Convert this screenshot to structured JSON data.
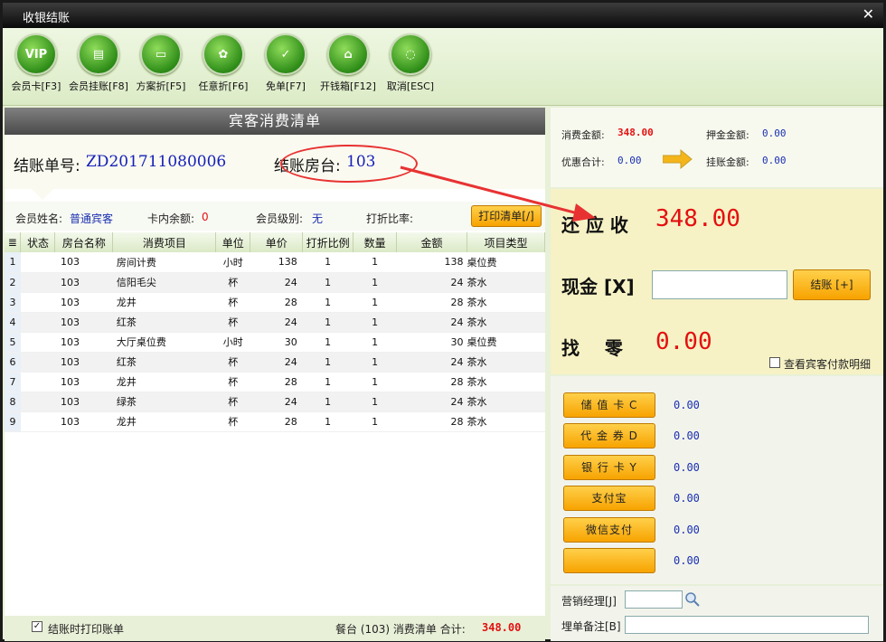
{
  "window": {
    "title": "收银结账",
    "close_label": "✕"
  },
  "toolbar": [
    {
      "label": "会员卡[F3]",
      "glyph": "VIP"
    },
    {
      "label": "会员挂账[F8]",
      "glyph": "▤"
    },
    {
      "label": "方案折[F5]",
      "glyph": "▭"
    },
    {
      "label": "任意折[F6]",
      "glyph": "✿"
    },
    {
      "label": "免单[F7]",
      "glyph": "✓"
    },
    {
      "label": "开钱箱[F12]",
      "glyph": "⌂"
    },
    {
      "label": "取消[ESC]",
      "glyph": "◌"
    }
  ],
  "left": {
    "header": "宾客消费清单",
    "bill_no_label": "结账单号:",
    "bill_no": "ZD201711080006",
    "room_label": "结账房台:",
    "room": "103",
    "member_name_label": "会员姓名:",
    "member_name": "普通宾客",
    "card_balance_label": "卡内余额:",
    "card_balance": "0",
    "member_level_label": "会员级别:",
    "member_level": "无",
    "discount_label": "打折比率:",
    "print_button": "打印清单[/]",
    "columns": [
      "状态",
      "房台名称",
      "消费项目",
      "单位",
      "单价",
      "打折比例",
      "数量",
      "金额",
      "项目类型"
    ],
    "rows": [
      {
        "n": "1",
        "room": "103",
        "item": "房间计费",
        "unit": "小时",
        "price": "138",
        "disc": "1",
        "qty": "1",
        "amount": "138",
        "type": "桌位费"
      },
      {
        "n": "2",
        "room": "103",
        "item": "信阳毛尖",
        "unit": "杯",
        "price": "24",
        "disc": "1",
        "qty": "1",
        "amount": "24",
        "type": "茶水"
      },
      {
        "n": "3",
        "room": "103",
        "item": "龙井",
        "unit": "杯",
        "price": "28",
        "disc": "1",
        "qty": "1",
        "amount": "28",
        "type": "茶水"
      },
      {
        "n": "4",
        "room": "103",
        "item": "红茶",
        "unit": "杯",
        "price": "24",
        "disc": "1",
        "qty": "1",
        "amount": "24",
        "type": "茶水"
      },
      {
        "n": "5",
        "room": "103",
        "item": "大厅桌位费",
        "unit": "小时",
        "price": "30",
        "disc": "1",
        "qty": "1",
        "amount": "30",
        "type": "桌位费"
      },
      {
        "n": "6",
        "room": "103",
        "item": "红茶",
        "unit": "杯",
        "price": "24",
        "disc": "1",
        "qty": "1",
        "amount": "24",
        "type": "茶水"
      },
      {
        "n": "7",
        "room": "103",
        "item": "龙井",
        "unit": "杯",
        "price": "28",
        "disc": "1",
        "qty": "1",
        "amount": "28",
        "type": "茶水"
      },
      {
        "n": "8",
        "room": "103",
        "item": "绿茶",
        "unit": "杯",
        "price": "24",
        "disc": "1",
        "qty": "1",
        "amount": "24",
        "type": "茶水"
      },
      {
        "n": "9",
        "room": "103",
        "item": "龙井",
        "unit": "杯",
        "price": "28",
        "disc": "1",
        "qty": "1",
        "amount": "28",
        "type": "茶水"
      }
    ],
    "footer_checkbox": "结账时打印账单",
    "footer_summary": "餐台 (103) 消费清单 合计:",
    "footer_total": "348.00"
  },
  "right": {
    "consume_label": "消费金额:",
    "consume": "348.00",
    "deposit_label": "押金金额:",
    "deposit": "0.00",
    "discount_total_label": "优惠合计:",
    "discount_total": "0.00",
    "onaccount_label": "挂账金额:",
    "onaccount": "0.00",
    "receivable_label": "还 应 收",
    "receivable": "348.00",
    "cash_label": "现金 [X]",
    "cash_value": "",
    "settle_button": "结账 [+]",
    "change_label": "找    零",
    "change": "0.00",
    "detail_checkbox": "查看宾客付款明细",
    "payments": [
      {
        "label": "储 值 卡 C",
        "value": "0.00"
      },
      {
        "label": "代 金 券 D",
        "value": "0.00"
      },
      {
        "label": "银 行 卡 Y",
        "value": "0.00"
      },
      {
        "label": "支付宝",
        "value": "0.00"
      },
      {
        "label": "微信支付",
        "value": "0.00"
      },
      {
        "label": "",
        "value": "0.00"
      }
    ],
    "manager_label": "营销经理[J]",
    "manager_value": "",
    "remark_label": "埋单备注[B]",
    "remark_value": ""
  },
  "colors": {
    "accent": "#f7a300",
    "amount_red": "#e41010",
    "value_blue": "#1a2fb0",
    "annotation": "#e83232"
  }
}
